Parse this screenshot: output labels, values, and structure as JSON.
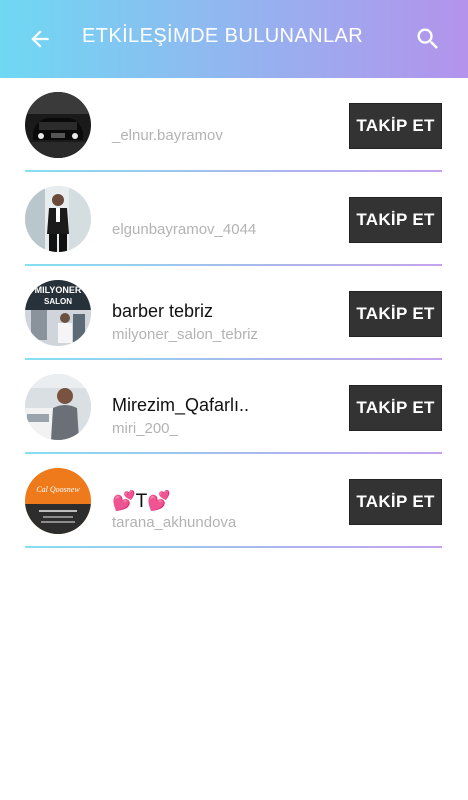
{
  "header": {
    "title": "ETKİLEŞİMDE BULUNANLAR",
    "back_icon": "arrow-left-icon",
    "search_icon": "search-icon"
  },
  "colors": {
    "header_gradient_start": "#6fd8f3",
    "header_gradient_end": "#b393ec",
    "follow_button_bg": "#333333"
  },
  "users": [
    {
      "name": "",
      "username": "_elnur.bayramov",
      "follow_label": "TAKİP ET"
    },
    {
      "name": "",
      "username": "elgunbayramov_4044",
      "follow_label": "TAKİP ET"
    },
    {
      "name": "barber tebriz",
      "username": "milyoner_salon_tebriz",
      "follow_label": "TAKİP ET"
    },
    {
      "name": "Mirezim_Qafarlı..",
      "username": "miri_200_",
      "follow_label": "TAKİP ET"
    },
    {
      "name": "💕T💕",
      "username": "tarana_akhundova",
      "follow_label": "TAKİP ET"
    }
  ],
  "avatar_texts": {
    "salon": "MILYONER SALON",
    "bakery": "Cal Qoosnew"
  }
}
